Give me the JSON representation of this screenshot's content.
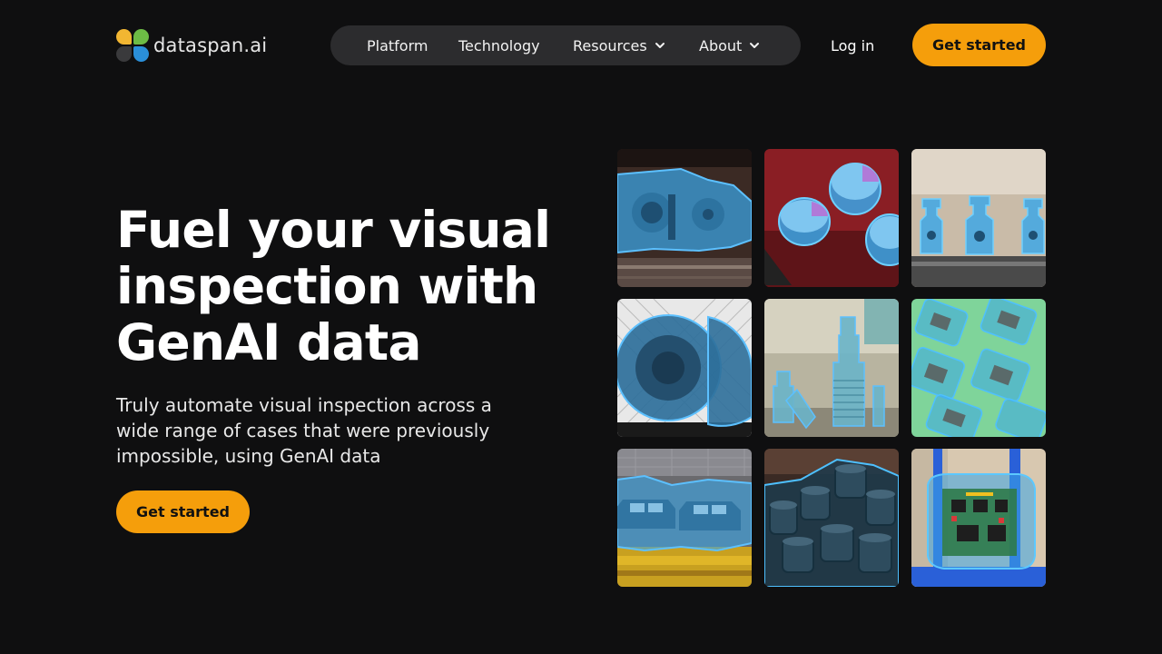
{
  "brand": {
    "name": "dataspan.ai"
  },
  "nav": {
    "items": [
      {
        "label": "Platform",
        "has_dropdown": false
      },
      {
        "label": "Technology",
        "has_dropdown": false
      },
      {
        "label": "Resources",
        "has_dropdown": true
      },
      {
        "label": "About",
        "has_dropdown": true
      }
    ],
    "login_label": "Log in",
    "cta_label": "Get started"
  },
  "hero": {
    "title_lines": [
      "Fuel your visual",
      "inspection with",
      "GenAI data"
    ],
    "subtitle_lines": [
      "Truly automate visual inspection across a",
      "wide range of cases that were previously",
      "impossible, using GenAI data"
    ],
    "cta_label": "Get started"
  },
  "colors": {
    "background": "#0f0f10",
    "accent": "#f59e0b",
    "nav_pill": "#2c2c2e",
    "segmentation_overlay": "#3aa6e8"
  },
  "gallery": {
    "tiles": [
      {
        "subject": "train bogie with segmentation overlay"
      },
      {
        "subject": "capacitors on red circuit board"
      },
      {
        "subject": "mechanical parts on conveyor"
      },
      {
        "subject": "gear wheels behind fence"
      },
      {
        "subject": "gear shafts on table"
      },
      {
        "subject": "circuit modules on green mat"
      },
      {
        "subject": "car bodies on assembly line"
      },
      {
        "subject": "black plastic gears"
      },
      {
        "subject": "electronics board on blue frame"
      }
    ]
  }
}
